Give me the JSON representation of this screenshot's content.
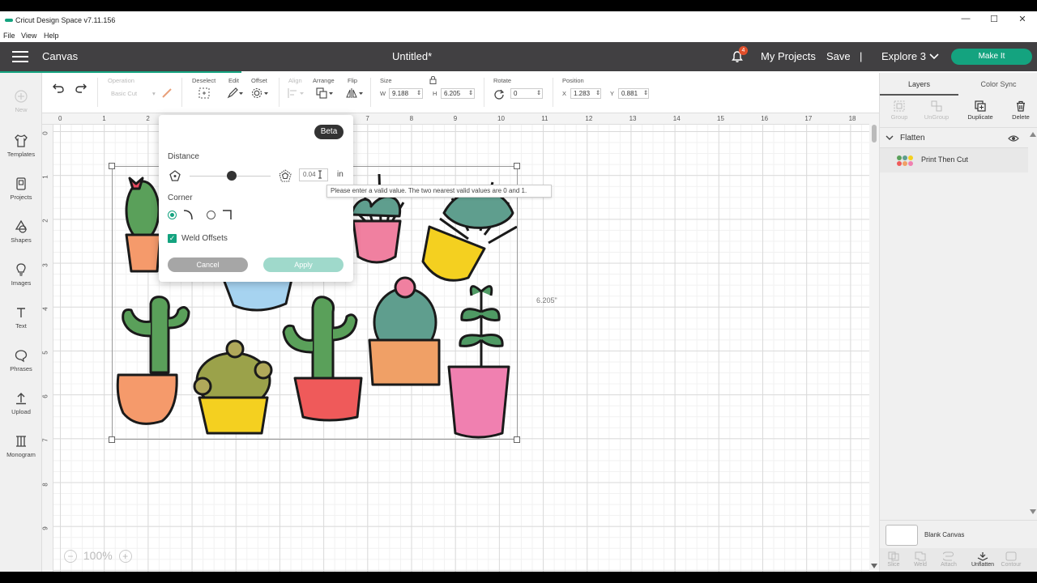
{
  "app": {
    "title": "Cricut Design Space  v7.11.156",
    "menu": [
      "File",
      "View",
      "Help"
    ],
    "window_controls": [
      "—",
      "☐",
      "✕"
    ]
  },
  "header": {
    "section": "Canvas",
    "doc_title": "Untitled*",
    "notification_count": "4",
    "my_projects": "My Projects",
    "save": "Save",
    "separator": "|",
    "machine": "Explore 3",
    "make_it": "Make It"
  },
  "leftbar": {
    "items": [
      {
        "label": "New",
        "icon": "plus-icon"
      },
      {
        "label": "Templates",
        "icon": "shirt-icon"
      },
      {
        "label": "Projects",
        "icon": "projects-icon"
      },
      {
        "label": "Shapes",
        "icon": "shapes-icon"
      },
      {
        "label": "Images",
        "icon": "bulb-icon"
      },
      {
        "label": "Text",
        "icon": "text-icon"
      },
      {
        "label": "Phrases",
        "icon": "speech-icon"
      },
      {
        "label": "Upload",
        "icon": "upload-icon"
      },
      {
        "label": "Monogram",
        "icon": "monogram-icon"
      }
    ]
  },
  "toolbar": {
    "operation_label": "Operation",
    "operation_value": "Basic Cut",
    "deselect": "Deselect",
    "edit": "Edit",
    "offset": "Offset",
    "align": "Align",
    "arrange": "Arrange",
    "flip": "Flip",
    "size_label": "Size",
    "w_label": "W",
    "w_value": "9.188",
    "h_label": "H",
    "h_value": "6.205",
    "rotate_label": "Rotate",
    "rotate_value": "0",
    "position_label": "Position",
    "x_label": "X",
    "x_value": "1.283",
    "y_label": "Y",
    "y_value": "0.881"
  },
  "rulers": {
    "top": [
      "0",
      "1",
      "2",
      "3",
      "4",
      "5",
      "6",
      "7",
      "8",
      "9",
      "10",
      "11",
      "12",
      "13",
      "14",
      "15",
      "16",
      "17",
      "18"
    ],
    "left": [
      "0",
      "1",
      "2",
      "3",
      "4",
      "5",
      "6",
      "7",
      "8",
      "9"
    ]
  },
  "canvas": {
    "height_label": "6.205\"",
    "zoom": "100%",
    "zoom_minus": "−",
    "zoom_plus": "+"
  },
  "offset_popup": {
    "beta": "Beta",
    "distance_label": "Distance",
    "distance_value": "0.04",
    "distance_unit": "in",
    "corner_label": "Corner",
    "weld_offsets": "Weld Offsets",
    "weld_checked": true,
    "cancel": "Cancel",
    "apply": "Apply",
    "tooltip": "Please enter a valid value. The two nearest valid values are 0 and 1."
  },
  "right_panel": {
    "tabs": [
      "Layers",
      "Color Sync"
    ],
    "tools": [
      {
        "label": "Group",
        "enabled": false
      },
      {
        "label": "UnGroup",
        "enabled": false
      },
      {
        "label": "Duplicate",
        "enabled": true
      },
      {
        "label": "Delete",
        "enabled": true
      }
    ],
    "group_name": "Flatten",
    "layer_name": "Print Then Cut",
    "blank_canvas": "Blank Canvas",
    "bottom_tools": [
      {
        "label": "Slice",
        "enabled": false
      },
      {
        "label": "Weld",
        "enabled": false
      },
      {
        "label": "Attach",
        "enabled": false
      },
      {
        "label": "Unflatten",
        "enabled": true
      },
      {
        "label": "Contour",
        "enabled": false
      }
    ]
  },
  "colors": {
    "accent": "#14a37f",
    "header_bg": "#414042",
    "badge": "#e04e2a"
  }
}
